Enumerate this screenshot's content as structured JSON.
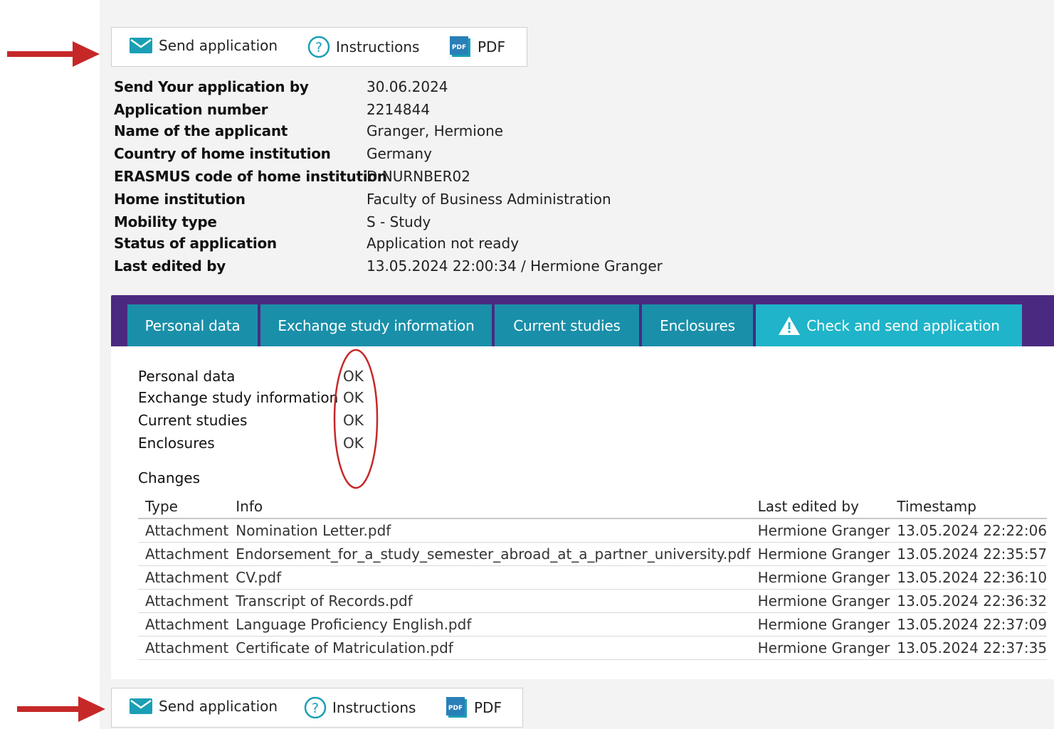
{
  "toolbar": {
    "send_label": "Send application",
    "instructions_label": "Instructions",
    "pdf_label": "PDF"
  },
  "application_info": [
    {
      "label": "Send Your application by",
      "value": "30.06.2024"
    },
    {
      "label": "Application number",
      "value": "2214844"
    },
    {
      "label": "Name of the applicant",
      "value": "Granger, Hermione"
    },
    {
      "label": "Country of home institution",
      "value": "Germany"
    },
    {
      "label": "ERASMUS code of home institution",
      "value": "D NURNBER02"
    },
    {
      "label": "Home institution",
      "value": "Faculty of Business Administration"
    },
    {
      "label": "Mobility type",
      "value": "S - Study"
    },
    {
      "label": "Status of application",
      "value": "Application not ready"
    },
    {
      "label": "Last edited by",
      "value": "13.05.2024 22:00:34 / Hermione Granger"
    }
  ],
  "tabs": [
    {
      "label": "Personal data"
    },
    {
      "label": "Exchange study information"
    },
    {
      "label": "Current studies"
    },
    {
      "label": "Enclosures"
    },
    {
      "label": "Check and send application"
    }
  ],
  "checks": [
    {
      "label": "Personal data",
      "status": "OK"
    },
    {
      "label": "Exchange study information",
      "status": "OK"
    },
    {
      "label": "Current studies",
      "status": "OK"
    },
    {
      "label": "Enclosures",
      "status": "OK"
    }
  ],
  "changes": {
    "title": "Changes",
    "headers": [
      "Type",
      "Info",
      "Last edited by",
      "Timestamp"
    ],
    "rows": [
      [
        "Attachment",
        "Nomination Letter.pdf",
        "Hermione Granger",
        "13.05.2024 22:22:06"
      ],
      [
        "Attachment",
        "Endorsement_for_a_study_semester_abroad_at_a_partner_university.pdf",
        "Hermione Granger",
        "13.05.2024 22:35:57"
      ],
      [
        "Attachment",
        "CV.pdf",
        "Hermione Granger",
        "13.05.2024 22:36:10"
      ],
      [
        "Attachment",
        "Transcript of Records.pdf",
        "Hermione Granger",
        "13.05.2024 22:36:32"
      ],
      [
        "Attachment",
        "Language Proficiency English.pdf",
        "Hermione Granger",
        "13.05.2024 22:37:09"
      ],
      [
        "Attachment",
        "Certificate of Matriculation.pdf",
        "Hermione Granger",
        "13.05.2024 22:37:35"
      ]
    ]
  },
  "colors": {
    "tab_bar": "#4a2a80",
    "tab": "#1a8fa9",
    "tab_active": "#1fb4c9",
    "annotation": "#c62828"
  }
}
